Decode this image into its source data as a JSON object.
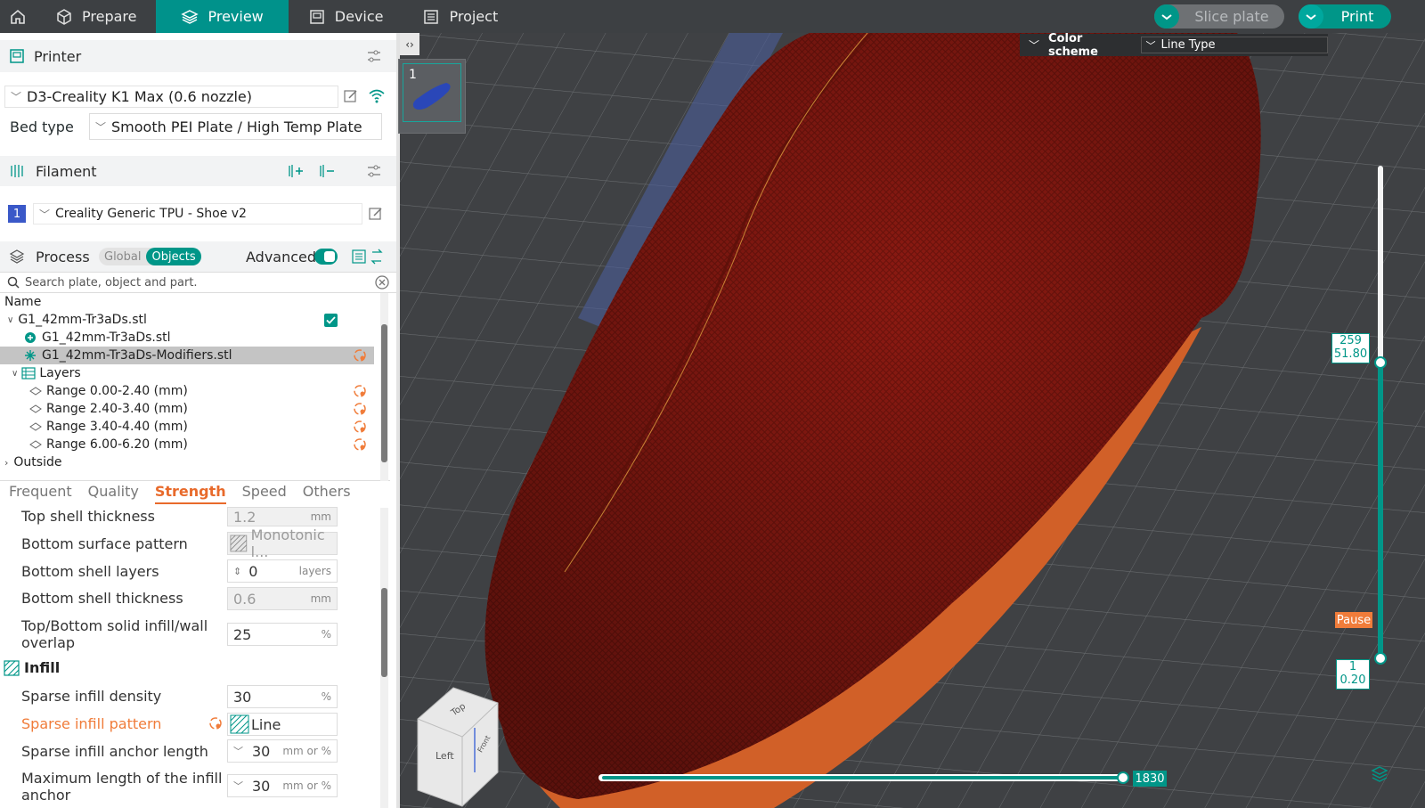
{
  "topbar": {
    "tabs": [
      {
        "label": "Prepare",
        "active": false
      },
      {
        "label": "Preview",
        "active": true
      },
      {
        "label": "Device",
        "active": false
      },
      {
        "label": "Project",
        "active": false
      }
    ],
    "slice_label": "Slice plate",
    "print_label": "Print",
    "accent_color": "#009688"
  },
  "printer": {
    "section_label": "Printer",
    "printer_name": "D3-Creality K1 Max (0.6 nozzle)",
    "bed_type_label": "Bed type",
    "bed_type_value": "Smooth PEI Plate / High Temp Plate"
  },
  "filament": {
    "section_label": "Filament",
    "slot_number": "1",
    "filament_name": "Creality Generic TPU - Shoe v2"
  },
  "process": {
    "section_label": "Process",
    "global_label": "Global",
    "objects_label": "Objects",
    "advanced_label": "Advanced",
    "search_placeholder": "Search plate, object and part."
  },
  "tree": {
    "header": "Name",
    "object": "G1_42mm-Tr3aDs.stl",
    "part": "G1_42mm-Tr3aDs.stl",
    "modifier": "G1_42mm-Tr3aDs-Modifiers.stl",
    "layers_label": "Layers",
    "ranges": [
      "Range 0.00-2.40 (mm)",
      "Range 2.40-3.40 (mm)",
      "Range 3.40-4.40 (mm)",
      "Range 6.00-6.20 (mm)"
    ],
    "outside_label": "Outside"
  },
  "param_tabs": [
    "Frequent",
    "Quality",
    "Strength",
    "Speed",
    "Others"
  ],
  "params": {
    "top_shell_thickness": {
      "label": "Top shell thickness",
      "value": "1.2",
      "unit": "mm"
    },
    "bottom_surface_pattern": {
      "label": "Bottom surface pattern",
      "value": "Monotonic l..."
    },
    "bottom_shell_layers": {
      "label": "Bottom shell layers",
      "value": "0",
      "unit": "layers"
    },
    "bottom_shell_thickness": {
      "label": "Bottom shell thickness",
      "value": "0.6",
      "unit": "mm"
    },
    "overlap_line1": "Top/Bottom solid infill/wall",
    "overlap_line2": "overlap",
    "overlap_value": "25",
    "overlap_unit": "%",
    "infill_header": "Infill",
    "sparse_density": {
      "label": "Sparse infill density",
      "value": "30",
      "unit": "%"
    },
    "sparse_pattern": {
      "label": "Sparse infill pattern",
      "value": "Line"
    },
    "anchor_length": {
      "label": "Sparse infill anchor length",
      "value": "30",
      "unit": "mm or %"
    },
    "max_anchor_line1": "Maximum length of the infill",
    "max_anchor_line2": "anchor",
    "max_anchor_value": "30",
    "max_anchor_unit": "mm or %"
  },
  "viewport": {
    "plate_number": "1",
    "color_scheme_label": "Color scheme",
    "color_scheme_value": "Line Type",
    "top_layer": "259",
    "top_height": "51.80",
    "bottom_layer": "1",
    "bottom_height": "0.20",
    "pause_label": "Pause",
    "move_value": "1830",
    "view_cube_top": "Top",
    "view_cube_left": "Left",
    "view_cube_front": "Front",
    "model_color": "#8c1a12"
  }
}
